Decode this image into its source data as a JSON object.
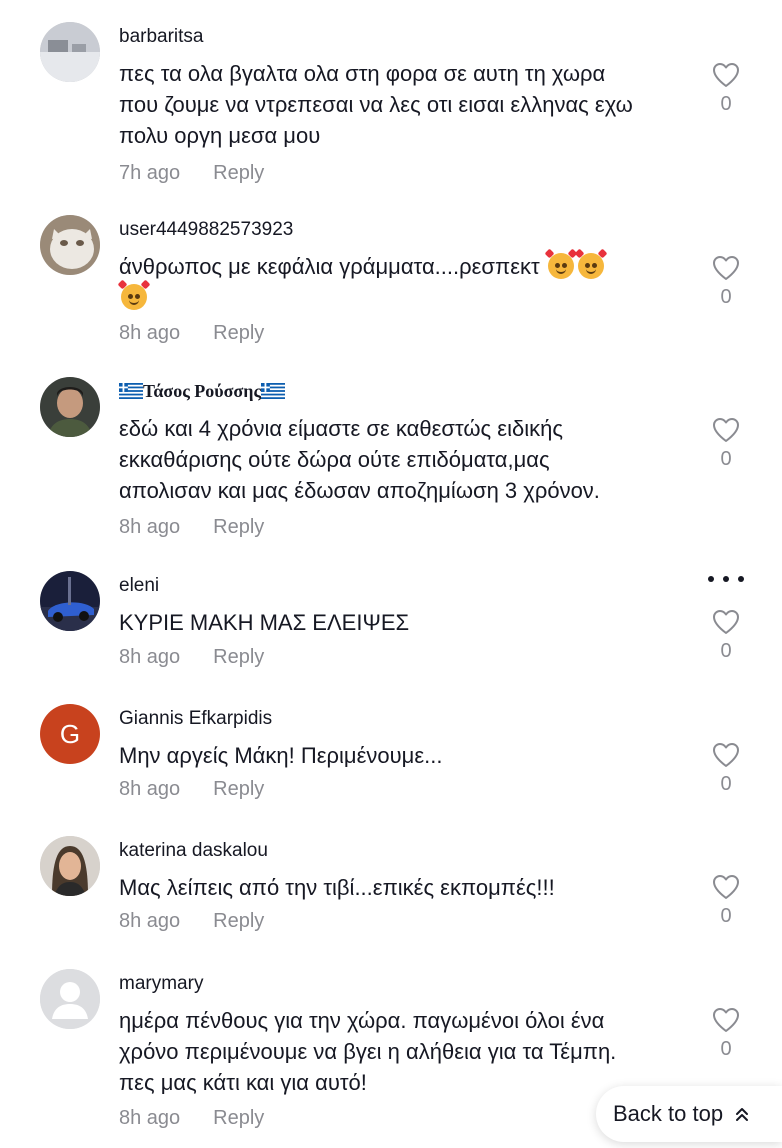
{
  "comments": [
    {
      "username": "barbaritsa",
      "text": "πες τα ολα βγαλτα ολα στη φορα σε αυτη τη χωρα\nπου ζουμε να ντρεπεσαι να λες οτι εισαι ελληνας εχω\nπολυ οργη μεσα μου",
      "time": "7h ago",
      "reply": "Reply",
      "likes": "0"
    },
    {
      "username": "user4449882573923",
      "text": "άνθρωπος με κεφάλια γράμματα....ρεσπεκτ",
      "time": "8h ago",
      "reply": "Reply",
      "likes": "0"
    },
    {
      "username": "Τάσος Ρούσσης",
      "text": "εδώ και 4 χρόνια είμαστε σε καθεστώς ειδικής\nεκκαθάρισης ούτε δώρα ούτε επιδόματα,μας\nαπολισαν και μας έδωσαν αποζημίωση 3 χρόνον.",
      "time": "8h ago",
      "reply": "Reply",
      "likes": "0"
    },
    {
      "username": "eleni",
      "text": "ΚΥΡΙΕ ΜΑΚΗ ΜΑΣ ΕΛΕΙΨΕΣ",
      "time": "8h ago",
      "reply": "Reply",
      "likes": "0"
    },
    {
      "username": "Giannis Efkarpidis",
      "avatar_letter": "G",
      "text": "Μην αργείς Μάκη! Περιμένουμε...",
      "time": "8h ago",
      "reply": "Reply",
      "likes": "0"
    },
    {
      "username": "katerina daskalou",
      "text": "Μας λείπεις από την τιβί...επικές εκπομπές!!!",
      "time": "8h ago",
      "reply": "Reply",
      "likes": "0"
    },
    {
      "username": "marymary",
      "text": "ημέρα πένθους για την χώρα. παγωμένοι όλοι ένα\nχρόνο περιμένουμε να βγει η αλήθεια για τα Τέμπη.\nπες μας κάτι και για αυτό!",
      "time": "8h ago",
      "reply": "Reply",
      "likes": "0"
    }
  ],
  "back_to_top": "Back to top",
  "colors": {
    "text": "#161823",
    "muted": "#8a8b91",
    "avatar_g": "#c8421e"
  },
  "icons": {
    "like": "heart-outline-icon",
    "more": "more-dots-icon",
    "back_to_top": "double-chevron-up-icon",
    "emoji": "smiling-face-with-hearts-emoji"
  }
}
